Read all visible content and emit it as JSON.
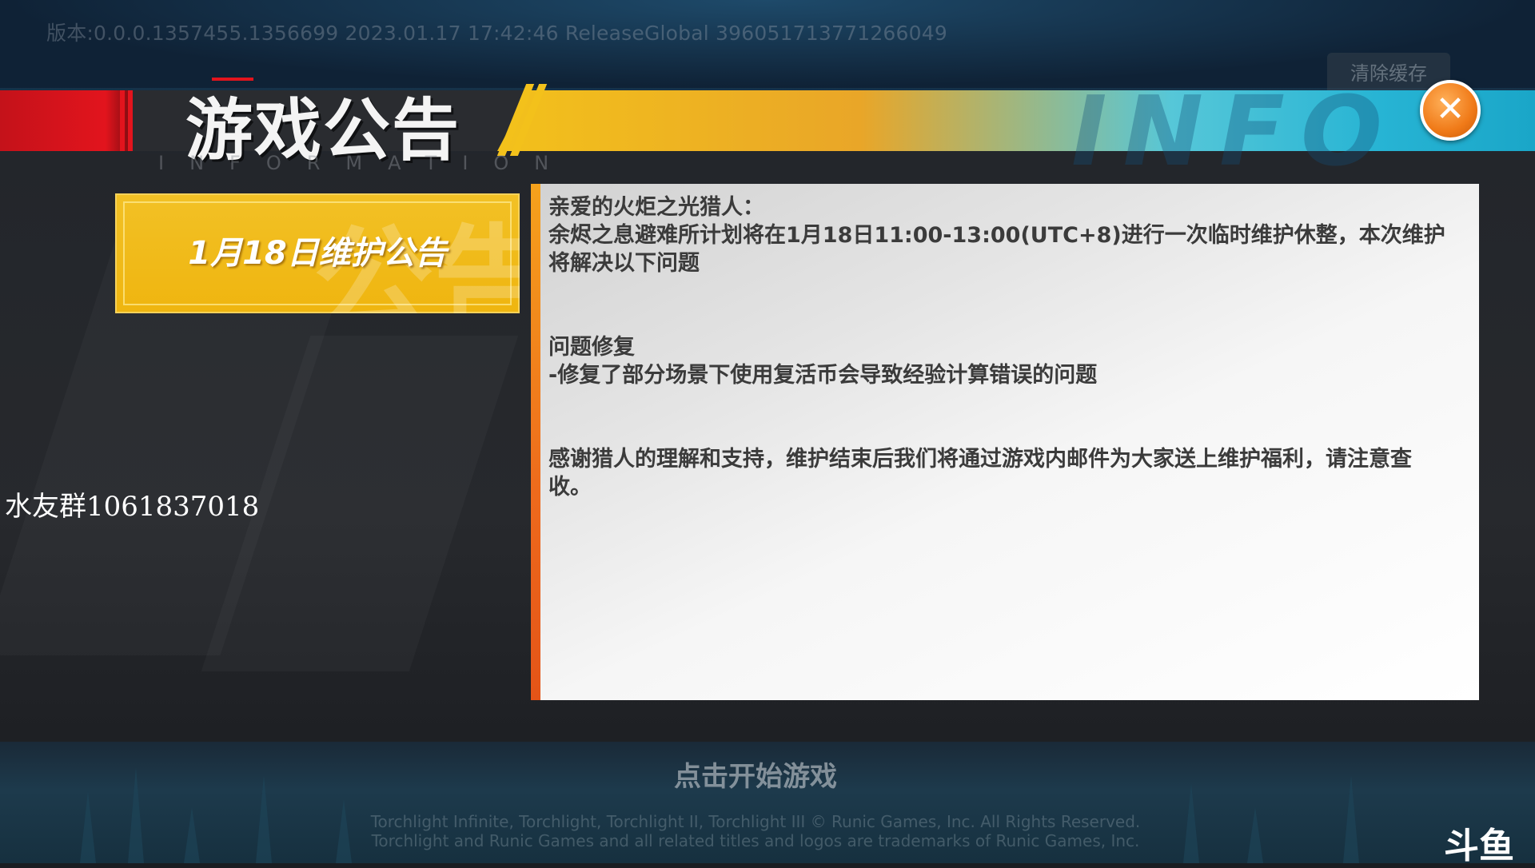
{
  "version_text": "版本:0.0.0.1357455.1356699 2023.01.17 17:42:46  ReleaseGlobal 3960517137712660​49",
  "clear_cache_label": "清除缓存",
  "header": {
    "title": "游戏公告",
    "subtitle": "INFORMATION",
    "close_icon": "close-icon"
  },
  "tabs": [
    {
      "label": "1月18日维护公告",
      "selected": true,
      "ghost": "公告"
    }
  ],
  "notice": {
    "paragraph1_line1": "亲爱的火炬之光猎人：",
    "paragraph1_line2": "余烬之息避难所计划将在1月18日11:00-13:00(UTC+8)进行一次临时维护休整，本次维护将解决以下问题",
    "section_title": "问题修复",
    "fix_item": "-修复了部分场景下使用复活币会导致经验计算错误的问题",
    "thanks": "感谢猎人的理解和支持，维护结束后我们将通过游戏内邮件为大家送上维护福利，请注意查收。"
  },
  "overlay_qq": "水友群1061837018",
  "start_label": "点击开始游戏",
  "copyright_line1": "Torchlight Infinite, Torchlight, Torchlight II, Torchlight III © Runic Games, Inc. All Rights Reserved.",
  "copyright_line2": "Torchlight and Runic Games and all related titles and logos are trademarks of Runic Games, Inc.",
  "stream_logo": "斗鱼",
  "colors": {
    "accent_gold": "#f2c126",
    "accent_red": "#e2141d",
    "accent_orange": "#f07a18",
    "accent_cyan": "#27b4d4"
  }
}
